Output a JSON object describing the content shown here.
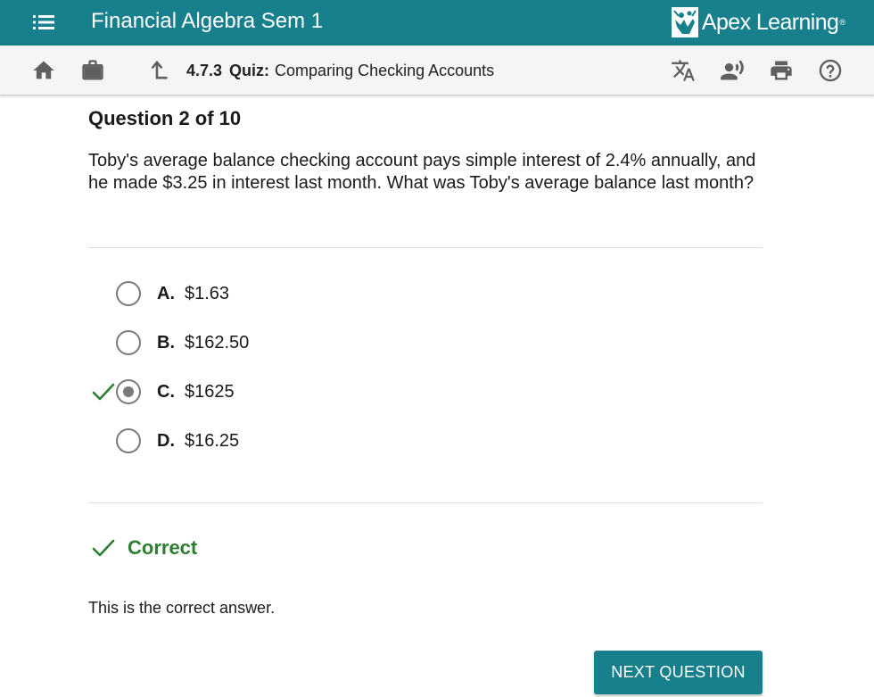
{
  "header": {
    "course_title": "Financial Algebra Sem 1",
    "brand_name": "Apex Learning",
    "brand_mark": "®",
    "bar_color": "#187f8d"
  },
  "toolbar": {
    "icons": [
      "home-icon",
      "briefcase-icon",
      "up-arrow-icon",
      "translate-icon",
      "text-to-speech-icon",
      "print-icon",
      "help-icon"
    ],
    "lesson_number": "4.7.3",
    "lesson_kind": "Quiz:",
    "lesson_name": "Comparing Checking Accounts"
  },
  "question": {
    "heading": "Question 2 of 10",
    "text": "Toby's average balance checking account pays simple interest of 2.4% annually, and he made $3.25 in interest last month. What was Toby's average balance last month?"
  },
  "options": [
    {
      "letter": "A.",
      "text": "$1.63",
      "selected": false
    },
    {
      "letter": "B.",
      "text": "$162.50",
      "selected": false
    },
    {
      "letter": "C.",
      "text": "$1625",
      "selected": true
    },
    {
      "letter": "D.",
      "text": "$16.25",
      "selected": false
    }
  ],
  "result": {
    "label": "Correct",
    "explanation": "This is the correct answer.",
    "color": "#2e7d32"
  },
  "next_button": {
    "label": "NEXT QUESTION"
  }
}
